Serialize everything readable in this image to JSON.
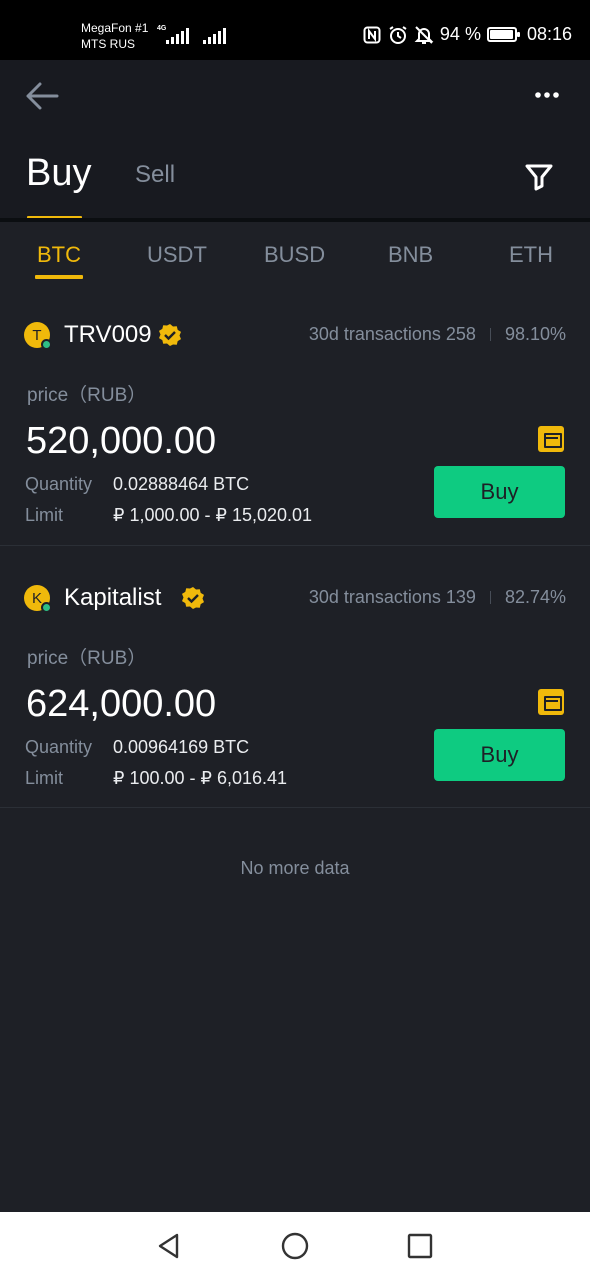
{
  "status_bar": {
    "carrier_1": "MegaFon #1",
    "carrier_2": "MTS RUS",
    "network_tag": "4G",
    "battery": "94 %",
    "battery_level": 0.94,
    "time": "08:16"
  },
  "header": {
    "tabs": [
      {
        "label": "Buy",
        "active": true
      },
      {
        "label": "Sell",
        "active": false
      }
    ],
    "back_icon": "arrow-left-icon",
    "more_icon": "more-dots-icon",
    "filter_icon": "filter-icon"
  },
  "coin_tabs": [
    {
      "label": "BTC",
      "active": true
    },
    {
      "label": "USDT",
      "active": false
    },
    {
      "label": "BUSD",
      "active": false
    },
    {
      "label": "BNB",
      "active": false
    },
    {
      "label": "ETH",
      "active": false
    }
  ],
  "offers": [
    {
      "avatar_letter": "T",
      "merchant": "TRV009",
      "stats_transactions": "30d transactions 258",
      "stats_rate": "98.10%",
      "price_label": "price（RUB）",
      "price": "520,000.00",
      "quantity_label": "Quantity",
      "quantity": "0.02888464 BTC",
      "limit_label": "Limit",
      "limit": "₽ 1,000.00 - ₽ 15,020.01",
      "buy_label": "Buy"
    },
    {
      "avatar_letter": "K",
      "merchant": "Kapitalist",
      "stats_transactions": "30d transactions 139",
      "stats_rate": "82.74%",
      "price_label": "price（RUB）",
      "price": "624,000.00",
      "quantity_label": "Quantity",
      "quantity": "0.00964169 BTC",
      "limit_label": "Limit",
      "limit": "₽ 100.00 - ₽ 6,016.41",
      "buy_label": "Buy"
    }
  ],
  "footer": {
    "no_more": "No more data"
  },
  "colors": {
    "accent": "#f0b90b",
    "buy_green": "#0ecb81",
    "background": "#1e2026"
  }
}
